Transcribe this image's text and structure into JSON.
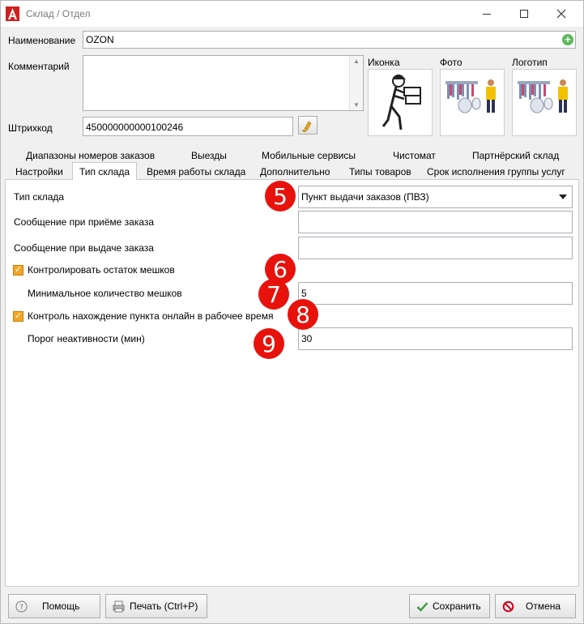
{
  "window": {
    "title": "Склад / Отдел"
  },
  "header": {
    "name_label": "Наименование",
    "name_value": "OZON",
    "comment_label": "Комментарий",
    "comment_value": "",
    "barcode_label": "Штрихкод",
    "barcode_value": "450000000000100246",
    "icon_label": "Иконка",
    "photo_label": "Фото",
    "logo_label": "Логотип"
  },
  "tabs": {
    "row1": [
      "Диапазоны номеров заказов",
      "Выезды",
      "Мобильные сервисы",
      "Чистомат",
      "Партнёрский склад"
    ],
    "row2": [
      "Настройки",
      "Тип склада",
      "Время работы склада",
      "Дополнительно",
      "Типы товаров",
      "Срок исполнения группы услуг"
    ],
    "active": "Тип склада"
  },
  "form": {
    "warehouse_type_label": "Тип склада",
    "warehouse_type_value": "Пункт выдачи заказов (ПВЗ)",
    "receive_msg_label": "Сообщение при приёме заказа",
    "receive_msg_value": "",
    "issue_msg_label": "Сообщение при выдаче заказа",
    "issue_msg_value": "",
    "control_bags_label": "Контролировать остаток мешков",
    "control_bags_checked": true,
    "min_bags_label": "Минимальное количество мешков",
    "min_bags_value": "5",
    "online_control_label": "Контроль нахождение пункта онлайн в рабочее время",
    "online_control_checked": true,
    "inactivity_label": "Порог неактивности (мин)",
    "inactivity_value": "30"
  },
  "markers": [
    "5",
    "6",
    "7",
    "8",
    "9"
  ],
  "buttons": {
    "help": "Помощь",
    "print": "Печать (Ctrl+P)",
    "save": "Сохранить",
    "cancel": "Отмена"
  },
  "colors": {
    "marker": "#e8120c",
    "checkbox": "#f5a623",
    "save_icon": "#3a9a3a",
    "cancel_icon": "#d0021b"
  }
}
